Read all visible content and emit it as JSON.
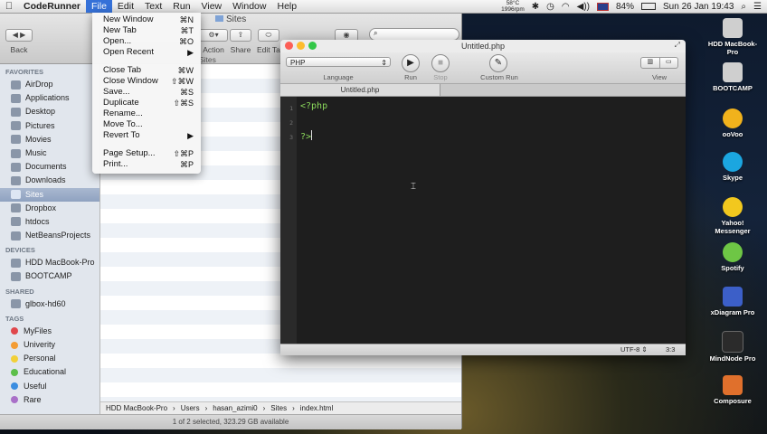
{
  "menubar": {
    "app": "CodeRunner",
    "items": [
      "File",
      "Edit",
      "Text",
      "Run",
      "View",
      "Window",
      "Help"
    ],
    "temp": "58°C",
    "rpm": "1996rpm",
    "battery": "84%",
    "clock": "Sun 26 Jan  19:43"
  },
  "file_menu": {
    "items": [
      {
        "label": "New Window",
        "shortcut": "⌘N"
      },
      {
        "label": "New Tab",
        "shortcut": "⌘T"
      },
      {
        "label": "Open...",
        "shortcut": "⌘O"
      },
      {
        "label": "Open Recent",
        "shortcut": "▶"
      },
      {
        "label": "Close Tab",
        "shortcut": "⌘W"
      },
      {
        "label": "Close Window",
        "shortcut": "⇧⌘W"
      },
      {
        "label": "Save...",
        "shortcut": "⌘S"
      },
      {
        "label": "Duplicate",
        "shortcut": "⇧⌘S"
      },
      {
        "label": "Rename...",
        "shortcut": ""
      },
      {
        "label": "Move To...",
        "shortcut": ""
      },
      {
        "label": "Revert To",
        "shortcut": "▶"
      },
      {
        "label": "Page Setup...",
        "shortcut": "⇧⌘P"
      },
      {
        "label": "Print...",
        "shortcut": "⌘P"
      }
    ]
  },
  "finder": {
    "title": "Sites",
    "back_label": "Back",
    "action_label": "Action",
    "share_label": "Share",
    "edit_tags_label": "Edit Ta",
    "path_header": "Sites",
    "favorites_head": "FAVORITES",
    "favorites": [
      "AirDrop",
      "Applications",
      "Desktop",
      "Pictures",
      "Movies",
      "Music",
      "Documents",
      "Downloads",
      "Sites",
      "Dropbox",
      "htdocs",
      "NetBeansProjects"
    ],
    "devices_head": "DEVICES",
    "devices": [
      "HDD MacBook-Pro",
      "BOOTCAMP"
    ],
    "shared_head": "SHARED",
    "shared": [
      "glbox-hd60"
    ],
    "tags_head": "TAGS",
    "tags": [
      {
        "label": "MyFiles",
        "color": "#e0474c"
      },
      {
        "label": "Univerity",
        "color": "#f39c34"
      },
      {
        "label": "Personal",
        "color": "#f2d038"
      },
      {
        "label": "Educational",
        "color": "#5cbf4a"
      },
      {
        "label": "Useful",
        "color": "#3b8de0"
      },
      {
        "label": "Rare",
        "color": "#a970c8"
      }
    ],
    "path": [
      "HDD MacBook-Pro",
      "Users",
      "hasan_azimi0",
      "Sites",
      "index.html"
    ],
    "status": "1 of 2 selected, 323.29 GB available"
  },
  "coderunner": {
    "title": "Untitled.php",
    "language": "PHP",
    "language_label": "Language",
    "run_label": "Run",
    "stop_label": "Stop",
    "custom_run_label": "Custom Run",
    "view_label": "View",
    "tab": "Untitled.php",
    "lines": [
      {
        "n": "1",
        "text": "<?php"
      },
      {
        "n": "2",
        "text": ""
      },
      {
        "n": "3",
        "text": "?>"
      }
    ],
    "encoding": "UTF-8",
    "position": "3:3"
  },
  "desktop_icons": [
    {
      "label": "HDD MacBook-Pro",
      "color": "#cfcfcf"
    },
    {
      "label": "BOOTCAMP",
      "color": "#cfcfcf"
    },
    {
      "label": "ooVoo",
      "color": "#f1b21c"
    },
    {
      "label": "Skype",
      "color": "#1ba6e0"
    },
    {
      "label": "Yahoo! Messenger",
      "color": "#f2c81e"
    },
    {
      "label": "Spotify",
      "color": "#6ec645"
    },
    {
      "label": "xDiagram Pro",
      "color": "#3c5fc8"
    },
    {
      "label": "MindNode Pro",
      "color": "#2b2b2b"
    },
    {
      "label": "Composure",
      "color": "#e0702c"
    }
  ]
}
